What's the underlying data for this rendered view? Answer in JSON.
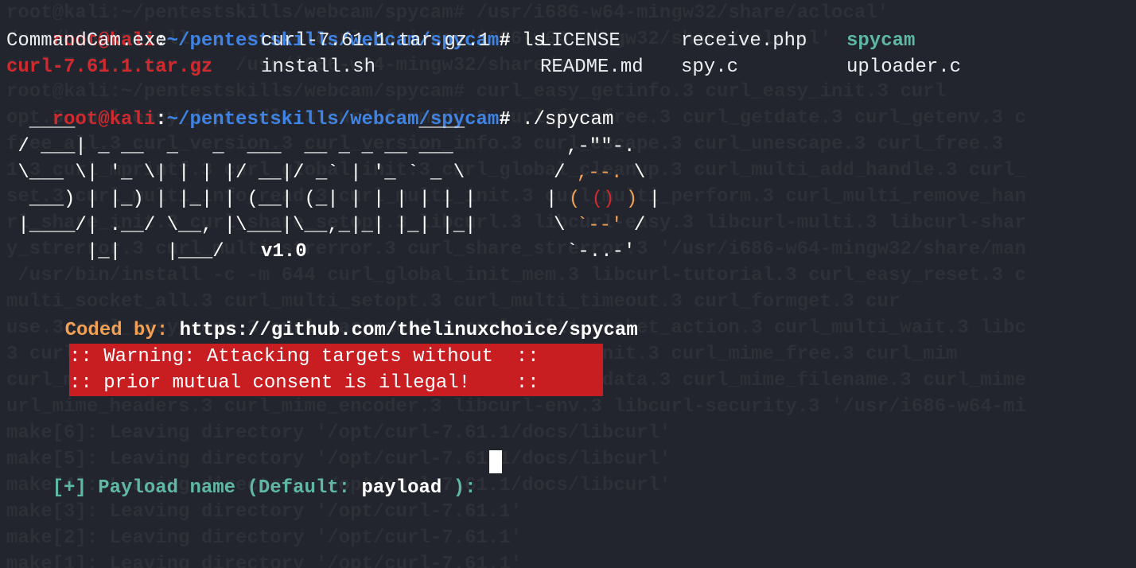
{
  "prompt1": {
    "user": "root@kali",
    "sep": ":",
    "path": "~/pentestskills/webcam/spycam",
    "symbol": "#",
    "command": "ls"
  },
  "ls": {
    "row1": [
      "CommandCam.exe",
      "curl-7.61.1.tar.gz.1",
      "LICENSE",
      "receive.php",
      "spycam"
    ],
    "row2": [
      "curl-7.61.1.tar.gz",
      "install.sh",
      "README.md",
      "spy.c",
      "uploader.c"
    ]
  },
  "prompt2": {
    "user": "root@kali",
    "sep": ":",
    "path": "~/pentestskills/webcam/spycam",
    "symbol": "#",
    "command": "./spycam"
  },
  "banner": {
    "ascii_lines": [
      "  ____                              ____",
      " / ___| _ __  _   _  ___  __ _ _ __ ___    ",
      " \\___ \\| '_ \\| | | |/ __|/ _` | '_ ` _ \\  ",
      "  ___) | |_) | |_| | (__| (_| | | | | | | ",
      " |____/| .__/ \\__, |\\___|\\__,_|_| |_| |_| ",
      "       |_|    |___/ "
    ],
    "version": "v1.0",
    "camera_lines": [
      ",-\"\"-.",
      "/ ,--. \\",
      "| ( () ) |",
      "\\ `--' /",
      "`-..-'"
    ]
  },
  "credits": {
    "label": "Coded by:",
    "url": "https://github.com/thelinuxchoice/spycam"
  },
  "warning": {
    "line1": ":: Warning: Attacking targets without  ::",
    "line2": ":: prior mutual consent is illegal!    ::"
  },
  "payload_prompt": {
    "prefix": "[+]",
    "text": "Payload name (Default:",
    "default": "payload",
    "suffix": "):"
  },
  "background_text": [
    "root@kali:~/pentestskills/webcam/spycam# /usr/i686-w64-mingw32/share/aclocal'",
    "/usr/bin/install -c -m 644 curl.m4 '/usr/i686-w64-mingw32/share/aclocal'",
    "curl-7.61.1.tar.gz  /usr/i686-w64-mingw32/share/man",
    "root@kali:~/pentestskills/webcam/spycam# curl_easy_getinfo.3 curl_easy_init.3 curl",
    "opt.3 curl_easy_duphandle.3 curl_formadd.3 curl_formfree.3 curl_getdate.3 curl_getenv.3 c",
    "free_all.3 curl_version.3 curl_version_info.3 curl_escape.3 curl_unescape.3 curl_free.3",
    "1.3 curl_mprintf.3 curl_global_init.3 curl_global_cleanup.3 curl_multi_add_handle.3 curl_",
    "set.3 curl_multi_info_read.3 curl_multi_init.3 curl_multi_perform.3 curl_multi_remove_han",
    "rl_share_init.3 curl_share_setopt.3 libcurl.3 libcurl-easy.3 libcurl-multi.3 libcurl-shar",
    "y_strerror.3 curl_multi_strerror.3 curl_share_strerror.3 '/usr/i686-w64-mingw32/share/man",
    " /usr/bin/install -c -m 644 curl_global_init_mem.3 libcurl-tutorial.3 curl_easy_reset.3 c",
    "multi_socket_all.3 curl_multi_setopt.3 curl_multi_timeout.3 curl_formget.3 cur",
    "use.3 curl_easy_recv.3 curl_easy_send.3 curl_multi_socket_action.3 curl_multi_wait.3 libc",
    "3 curl_multi_socket.3 curl_easy_upkeep.3 curl_mime_init.3 curl_mime_free.3 curl_mim",
    "curl_mime_type.3 curl_mime_filename.3 curl_mime_filedata.3 curl_mime_filename.3 curl_mime",
    "url_mime_headers.3 curl_mime_encoder.3 libcurl-env.3 libcurl-security.3 '/usr/i686-w64-mi",
    "make[6]: Leaving directory '/opt/curl-7.61.1/docs/libcurl'",
    "make[5]: Leaving directory '/opt/curl-7.61.1/docs/libcurl'",
    "make[4]: Leaving directory '/opt/curl-7.61.1/docs/libcurl'",
    "make[3]: Leaving directory '/opt/curl-7.61.1'",
    "make[2]: Leaving directory '/opt/curl-7.61.1'",
    "make[1]: Leaving directory '/opt/curl-7.61.1'"
  ],
  "colors": {
    "background": "#22252d",
    "prompt_user": "#d02a2e",
    "prompt_path": "#3f84e5",
    "text": "#eceff1",
    "accent_teal": "#5eb8a3",
    "accent_orange": "#f2a054",
    "warning_bg": "#c81e22"
  }
}
